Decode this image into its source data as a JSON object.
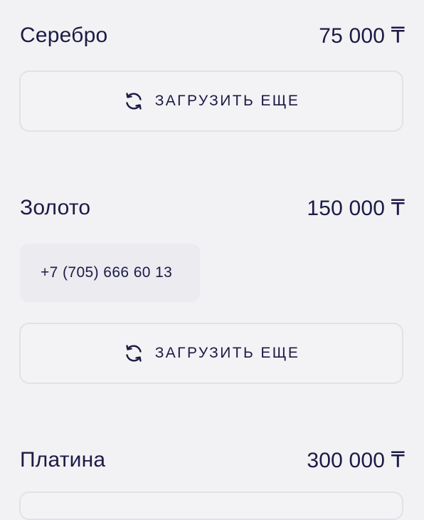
{
  "sections": [
    {
      "name": "Серебро",
      "price": "75 000 ₸",
      "load_more_label": "ЗАГРУЗИТЬ ЕЩЕ"
    },
    {
      "name": "Золото",
      "price": "150 000 ₸",
      "phone": "+7 (705) 666 60 13",
      "load_more_label": "ЗАГРУЗИТЬ ЕЩЕ"
    },
    {
      "name": "Платина",
      "price": "300 000 ₸"
    }
  ],
  "icons": {
    "load_more": "refresh-icon"
  },
  "colors": {
    "text": "#1c1a46",
    "background": "#f2f2f4",
    "button_border": "#e2e2e6",
    "phone_card_bg": "#ebebf0"
  }
}
